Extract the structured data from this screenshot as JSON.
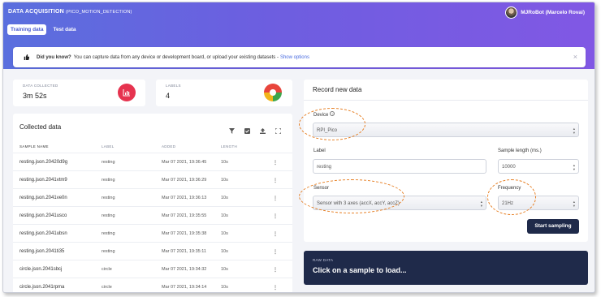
{
  "header": {
    "title": "DATA ACQUISITION",
    "project": "(PICO_MOTION_DETECTION)",
    "user": "MJRoBot (Marcelo Rovai)"
  },
  "tabs": [
    {
      "label": "Training data",
      "active": true
    },
    {
      "label": "Test data",
      "active": false
    }
  ],
  "banner": {
    "title": "Did you know?",
    "text": "You can capture data from any device or development board, or upload your existing datasets -",
    "link": "Show options",
    "close": "×"
  },
  "stats": {
    "collected": {
      "label": "DATA COLLECTED",
      "value": "3m 52s"
    },
    "labels": {
      "label": "LABELS",
      "value": "4"
    }
  },
  "collected": {
    "title": "Collected data",
    "columns": [
      "SAMPLE NAME",
      "LABEL",
      "ADDED",
      "LENGTH"
    ],
    "rows": [
      {
        "name": "resting.json.20420d9g",
        "label": "resting",
        "added": "Mar 07 2021, 19:36:45",
        "length": "10s"
      },
      {
        "name": "resting.json.2041vtm9",
        "label": "resting",
        "added": "Mar 07 2021, 19:36:29",
        "length": "10s"
      },
      {
        "name": "resting.json.2041ve0n",
        "label": "resting",
        "added": "Mar 07 2021, 19:36:13",
        "length": "10s"
      },
      {
        "name": "resting.json.2041usco",
        "label": "resting",
        "added": "Mar 07 2021, 19:35:55",
        "length": "10s"
      },
      {
        "name": "resting.json.2041ubsn",
        "label": "resting",
        "added": "Mar 07 2021, 19:35:38",
        "length": "10s"
      },
      {
        "name": "resting.json.2041ti35",
        "label": "resting",
        "added": "Mar 07 2021, 19:35:11",
        "length": "10s"
      },
      {
        "name": "circle.json.2041sbcj",
        "label": "circle",
        "added": "Mar 07 2021, 19:34:32",
        "length": "10s"
      },
      {
        "name": "circle.json.2041rpma",
        "label": "circle",
        "added": "Mar 07 2021, 19:34:14",
        "length": "10s"
      }
    ],
    "row_menu": "⋮"
  },
  "record": {
    "title": "Record new data",
    "device_label": "Device",
    "device_value": "RPI_Pico",
    "label_label": "Label",
    "label_value": "resting",
    "length_label": "Sample length (ms.)",
    "length_value": "10000",
    "sensor_label": "Sensor",
    "sensor_value": "Sensor with 3 axes (accX, accY, accZ)",
    "frequency_label": "Frequency",
    "frequency_value": "21Hz",
    "start_button": "Start sampling"
  },
  "raw": {
    "label": "RAW DATA",
    "message": "Click on a sample to load..."
  },
  "colors": {
    "header_gradient_start": "#5a6fde",
    "header_gradient_end": "#8158e4",
    "dark_navy": "#1f2a4a",
    "annotation": "#e67e22",
    "accent_red": "#e6334f"
  },
  "icons": [
    "thumbs-up-icon",
    "bar-chart-icon",
    "pie-chart-icon",
    "filter-icon",
    "checkbox-icon",
    "upload-icon",
    "expand-icon",
    "help-icon",
    "close-icon"
  ]
}
